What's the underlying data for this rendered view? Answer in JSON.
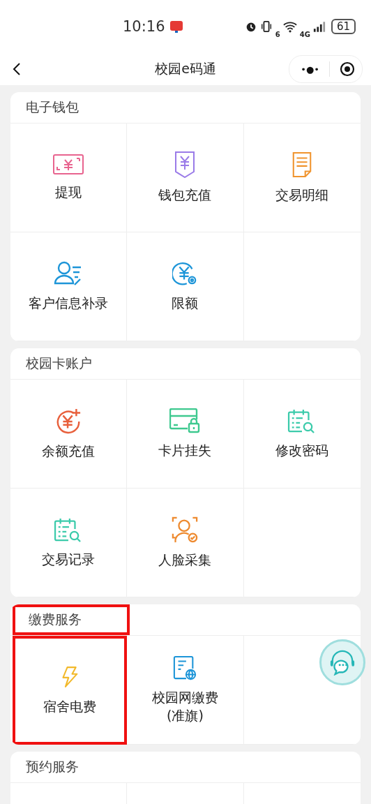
{
  "status_bar": {
    "time": "10:16",
    "wifi_label": "6",
    "network": "4G",
    "battery": "61"
  },
  "nav": {
    "title": "校园e码通",
    "more": "•●•"
  },
  "sections": [
    {
      "title": "电子钱包",
      "highlighted": false,
      "items": [
        {
          "label": "提现",
          "highlighted": false
        },
        {
          "label": "钱包充值",
          "highlighted": false
        },
        {
          "label": "交易明细",
          "highlighted": false
        },
        {
          "label": "客户信息补录",
          "highlighted": false
        },
        {
          "label": "限额",
          "highlighted": false
        }
      ]
    },
    {
      "title": "校园卡账户",
      "highlighted": false,
      "items": [
        {
          "label": "余额充值",
          "highlighted": false
        },
        {
          "label": "卡片挂失",
          "highlighted": false
        },
        {
          "label": "修改密码",
          "highlighted": false
        },
        {
          "label": "交易记录",
          "highlighted": false
        },
        {
          "label": "人脸采集",
          "highlighted": false
        }
      ]
    },
    {
      "title": "缴费服务",
      "highlighted": true,
      "items": [
        {
          "label": "宿舍电费",
          "highlighted": true
        },
        {
          "label": "校园网缴费\n(准旗)",
          "highlighted": false
        }
      ]
    },
    {
      "title": "预约服务",
      "highlighted": false
    }
  ]
}
